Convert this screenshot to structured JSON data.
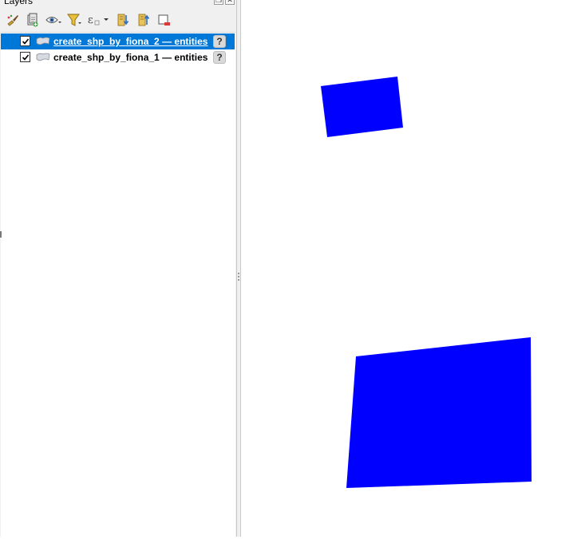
{
  "panel": {
    "title": "Layers",
    "title_buttons": [
      "float-icon",
      "close-icon"
    ]
  },
  "toolbar": {
    "buttons": [
      {
        "name": "style-manager-button",
        "icon": "paintbrush-icon"
      },
      {
        "name": "add-group-button",
        "icon": "add-group-icon"
      },
      {
        "name": "manage-visibility-button",
        "icon": "eye-icon"
      },
      {
        "name": "filter-legend-button",
        "icon": "filter-icon"
      },
      {
        "name": "filter-by-expression-button",
        "icon": "epsilon-icon"
      },
      {
        "name": "expand-all-button",
        "icon": "expand-all-icon"
      },
      {
        "name": "collapse-all-button",
        "icon": "collapse-all-icon"
      },
      {
        "name": "remove-layer-button",
        "icon": "remove-layer-icon"
      }
    ]
  },
  "layers": [
    {
      "label": "create_shp_by_fiona_2 — entities",
      "checked": true,
      "selected": true,
      "warning_icon": "question-icon"
    },
    {
      "label": "create_shp_by_fiona_1 — entities",
      "checked": true,
      "selected": false,
      "warning_icon": "question-icon"
    }
  ],
  "map": {
    "fill_color": "#0000ff",
    "features": [
      {
        "name": "polygon-layer-2"
      },
      {
        "name": "polygon-layer-1"
      }
    ]
  },
  "colors": {
    "selection": "#0078d7",
    "panel_bg": "#f0f0f0"
  }
}
